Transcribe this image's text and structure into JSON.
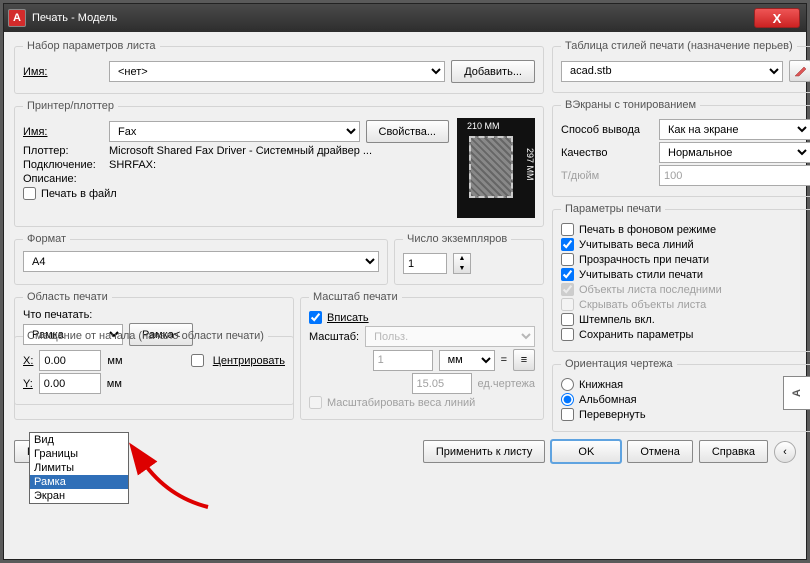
{
  "window": {
    "title": "Печать - Модель",
    "app_letter": "A",
    "close": "X"
  },
  "pagesetup": {
    "legend": "Набор параметров листа",
    "name_label": "Имя:",
    "name_value": "<нет>",
    "add_btn": "Добавить..."
  },
  "plotstyles": {
    "legend": "Таблица стилей печати (назначение перьев)",
    "value": "acad.stb",
    "btn_icon": "pencil-icon"
  },
  "printer": {
    "legend": "Принтер/плоттер",
    "name_label": "Имя:",
    "name_value": "Fax",
    "props_btn": "Свойства...",
    "plotter_label": "Плоттер:",
    "plotter_value": "Microsoft Shared Fax Driver - Системный драйвер ...",
    "conn_label": "Подключение:",
    "conn_value": "SHRFAX:",
    "desc_label": "Описание:",
    "plot_to_file": "Печать в файл",
    "preview_w": "210 MM",
    "preview_h": "297 MM"
  },
  "shaded": {
    "legend": "ВЭкраны с тонированием",
    "output_label": "Способ вывода",
    "output_value": "Как на экране",
    "quality_label": "Качество",
    "quality_value": "Нормальное",
    "dpi_label": "Т/дюйм",
    "dpi_value": "100"
  },
  "paper": {
    "legend": "Формат",
    "value": "A4"
  },
  "copies": {
    "legend": "Число экземпляров",
    "value": "1"
  },
  "options": {
    "legend": "Параметры печати",
    "items": [
      {
        "label": "Печать в фоновом режиме",
        "checked": false,
        "disabled": false
      },
      {
        "label": "Учитывать веса линий",
        "checked": true,
        "disabled": false
      },
      {
        "label": "Прозрачность при печати",
        "checked": false,
        "disabled": false
      },
      {
        "label": "Учитывать стили печати",
        "checked": true,
        "disabled": false
      },
      {
        "label": "Объекты листа последними",
        "checked": true,
        "disabled": true
      },
      {
        "label": "Скрывать объекты листа",
        "checked": false,
        "disabled": true
      },
      {
        "label": "Штемпель вкл.",
        "checked": false,
        "disabled": false
      },
      {
        "label": "Сохранить параметры",
        "checked": false,
        "disabled": false
      }
    ]
  },
  "area": {
    "legend": "Область печати",
    "what_label": "Что печатать:",
    "value": "Рамка",
    "window_btn": "Рамка<",
    "options": [
      "Вид",
      "Границы",
      "Лимиты",
      "Рамка",
      "Экран"
    ]
  },
  "scale": {
    "legend": "Масштаб печати",
    "fit_label": "Вписать",
    "fit_checked": true,
    "scale_label": "Масштаб:",
    "scale_value": "Польз.",
    "val1": "1",
    "unit": "мм",
    "eq": "=",
    "val2": "15.05",
    "unit2": "ед.чертежа",
    "scale_lw": "Масштабировать веса линий"
  },
  "offset": {
    "legend": "Смещение от начала (начало области печати)",
    "x_label": "X:",
    "y_label": "Y:",
    "val": "0.00",
    "unit": "мм",
    "center": "Центрировать"
  },
  "orient": {
    "legend": "Ориентация чертежа",
    "portrait": "Книжная",
    "landscape": "Альбомная",
    "upside": "Перевернуть",
    "icon_letter": "A"
  },
  "buttons": {
    "preview": "Просмотр...",
    "apply": "Применить к листу",
    "ok": "OK",
    "cancel": "Отмена",
    "help": "Справка",
    "expand": "‹"
  }
}
